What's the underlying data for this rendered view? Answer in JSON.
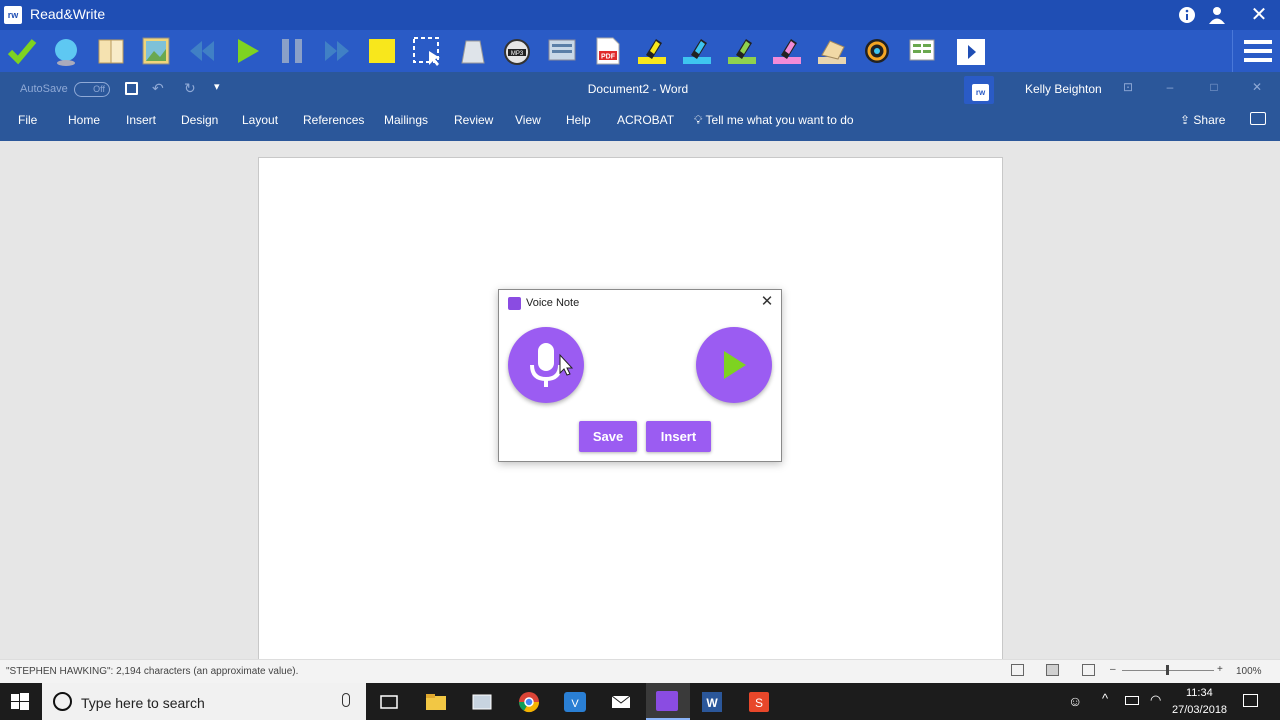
{
  "rw": {
    "title": "Read&Write",
    "logo_text": "rw",
    "toolbar": [
      "check-it",
      "prediction",
      "dictionary",
      "picture-dictionary",
      "rewind",
      "play",
      "pause",
      "fast-forward",
      "screen-masking",
      "screenshot-reader",
      "audio-maker",
      "speech-maker",
      "simplify",
      "pdf-reader",
      "highlight-yellow",
      "highlight-blue",
      "highlight-green",
      "highlight-pink",
      "collect-highlights",
      "vocabulary",
      "voice-note",
      "more"
    ]
  },
  "word": {
    "autosave_label": "AutoSave",
    "autosave_state": "Off",
    "doc_title": "Document2  -  Word",
    "user_name": "Kelly Beighton",
    "tabs": [
      "File",
      "Home",
      "Insert",
      "Design",
      "Layout",
      "References",
      "Mailings",
      "Review",
      "View",
      "Help",
      "ACROBAT"
    ],
    "tell_me": "Tell me what you want to do",
    "share": "Share"
  },
  "dialog": {
    "title": "Voice Note",
    "save": "Save",
    "insert": "Insert"
  },
  "status": {
    "text": "\"STEPHEN HAWKING\": 2,194 characters (an approximate value).",
    "zoom": "100%"
  },
  "taskbar": {
    "search_placeholder": "Type here to search",
    "time": "11:34",
    "date": "27/03/2018"
  },
  "colors": {
    "rw_blue": "#1f4eb4",
    "word_blue": "#2b579a",
    "accent_purple": "#9b5cf2"
  }
}
